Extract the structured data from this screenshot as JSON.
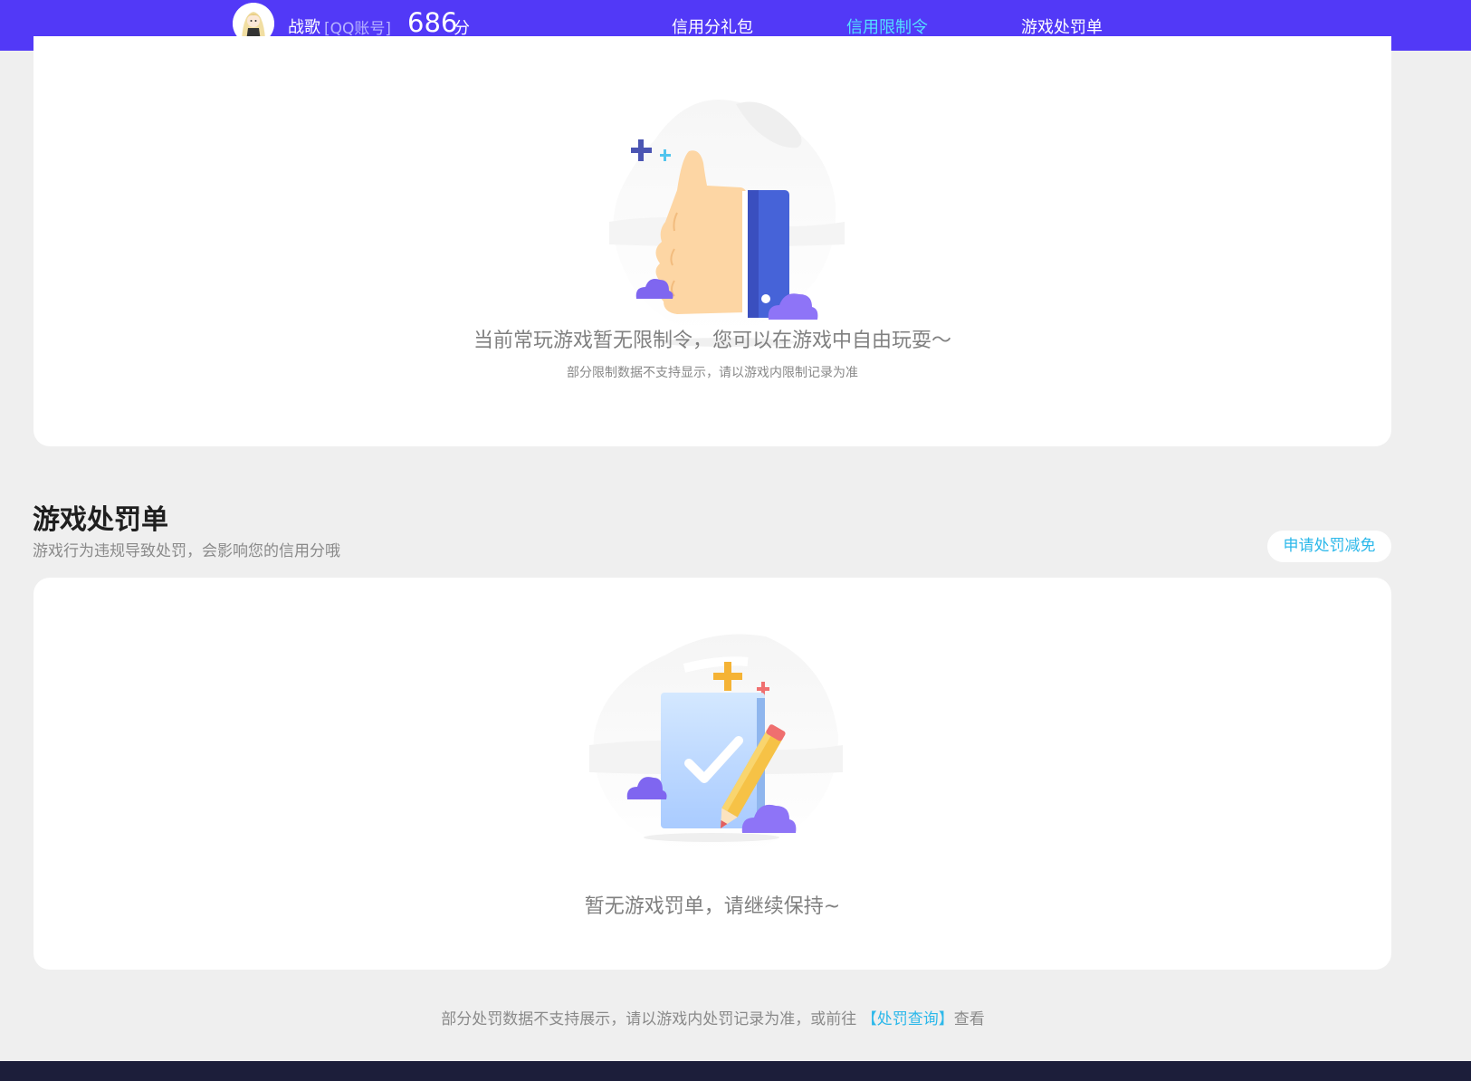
{
  "header": {
    "username": "战歌",
    "account_type": "[QQ账号]",
    "score": "686",
    "score_unit": "分",
    "nav": [
      {
        "label": "信用分礼包",
        "active": false
      },
      {
        "label": "信用限制令",
        "active": true
      },
      {
        "label": "游戏处罚单",
        "active": false
      }
    ],
    "colors": {
      "bar": "#5239f7",
      "active": "#54e0ff"
    }
  },
  "restriction": {
    "empty_message": "当前常玩游戏暂无限制令，您可以在游戏中自由玩耍～",
    "note": "部分限制数据不支持显示，请以游戏内限制记录为准",
    "illustration_icon": "thumbs-up-icon"
  },
  "penalty": {
    "title": "游戏处罚单",
    "description": "游戏行为违规导致处罚，会影响您的信用分哦",
    "apply_button": "申请处罚减免",
    "empty_message": "暂无游戏罚单，请继续保持~",
    "illustration_icon": "checked-document-icon"
  },
  "footer": {
    "note_before": "部分处罚数据不支持展示，请以游戏内处罚记录为准，或前往 ",
    "link": "【处罚查询】",
    "note_after": "查看"
  }
}
